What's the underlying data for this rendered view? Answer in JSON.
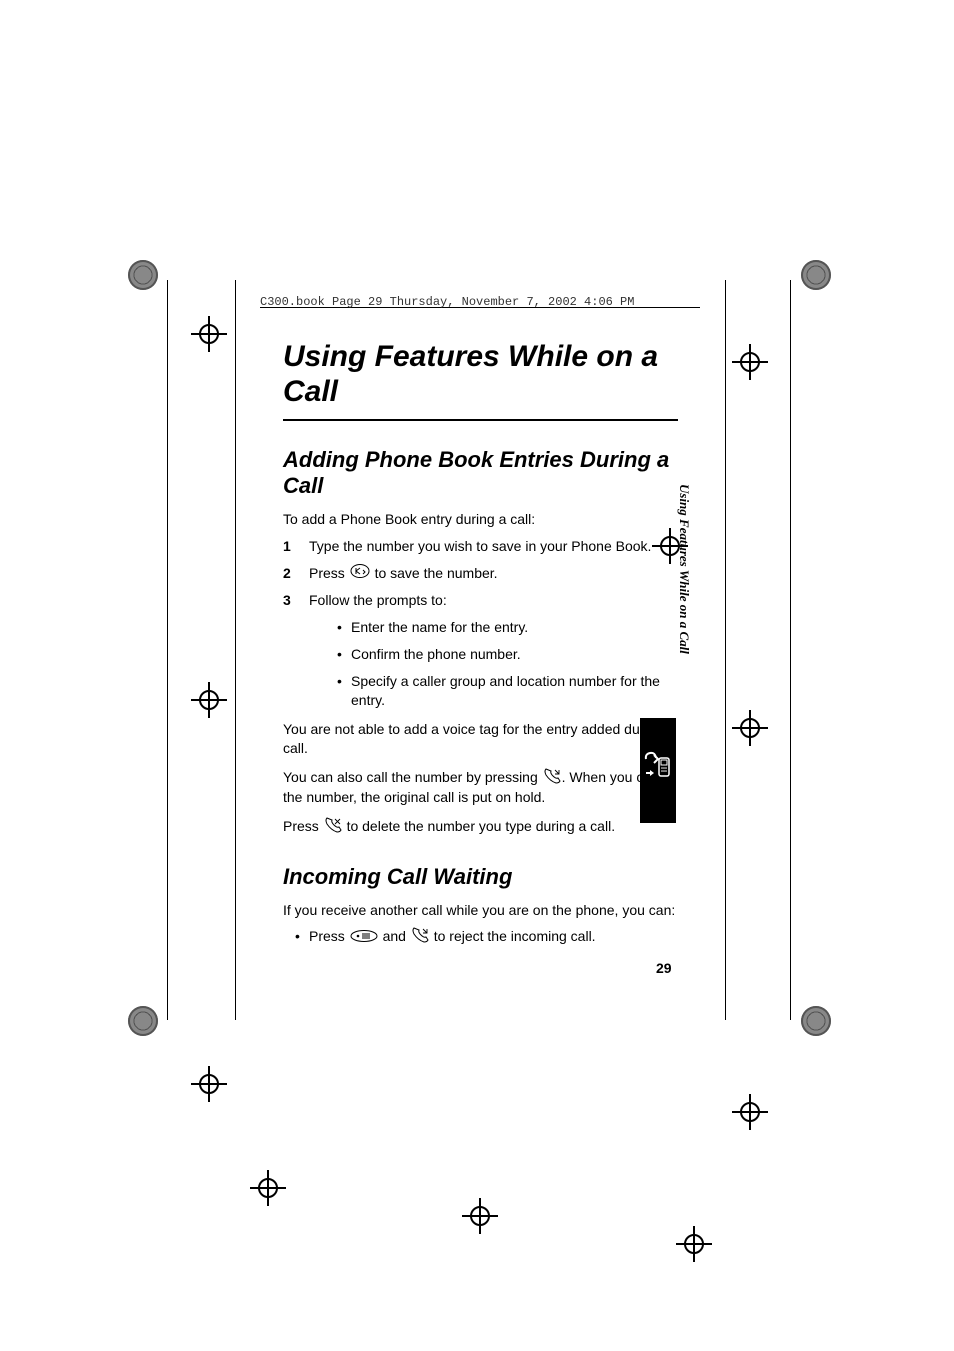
{
  "header": "C300.book  Page 29  Thursday, November 7, 2002  4:06 PM",
  "chapter": "Using Features While on a Call",
  "section1": {
    "title": "Adding Phone Book Entries During a Call",
    "intro": "To add a Phone Book entry during a call:",
    "steps": [
      "Type the number you wish to save in your Phone Book.",
      "Press  to save the number.",
      "Follow the prompts to:"
    ],
    "step2_before": "Press ",
    "step2_after": " to save the number.",
    "step3_bullets": [
      "Enter the name for the entry.",
      "Confirm the phone number.",
      "Specify a caller group and location number for the entry."
    ],
    "para_voicetag": "You are not able to add a voice tag for the entry added during a call.",
    "para_callnum_before": "You can also call the number by pressing ",
    "para_callnum_after": ". When you call the number, the original call is put on hold.",
    "para_delete_before": "Press ",
    "para_delete_after": " to delete the number you type during a call."
  },
  "section2": {
    "title": "Incoming Call Waiting",
    "intro": "If you receive another call while you are on the phone, you can:",
    "bullet1_a": "Press ",
    "bullet1_b": " and ",
    "bullet1_c": " to reject the incoming call."
  },
  "side_tab": "Using Features While on a Call",
  "page_number": "29",
  "icons": {
    "ok_key": "ok-key-icon",
    "send_key": "send-key-icon",
    "end_key": "end-key-icon",
    "clear_key": "clear-key-icon",
    "menu_key": "menu-key-icon",
    "phone_recall": "phone-recall-icon"
  }
}
